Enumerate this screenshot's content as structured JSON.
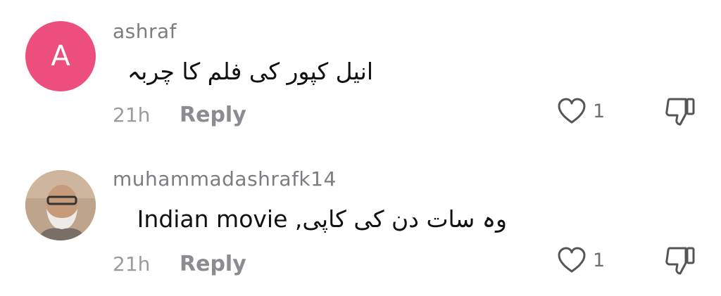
{
  "comments": [
    {
      "avatar_letter": "A",
      "avatar_color": "#ec4f7e",
      "username": "ashraf",
      "text": "انیل کپور کی فلم کا چربہ",
      "time": "21h",
      "reply_label": "Reply",
      "likes": "1"
    },
    {
      "avatar_letter": "",
      "username": "muhammadashrafk14",
      "text": "وہ سات دن کی کاپی, Indian movie",
      "time": "21h",
      "reply_label": "Reply",
      "likes": "1"
    }
  ],
  "icons": {
    "like": "heart-outline-icon",
    "dislike": "thumbs-down-outline-icon"
  }
}
